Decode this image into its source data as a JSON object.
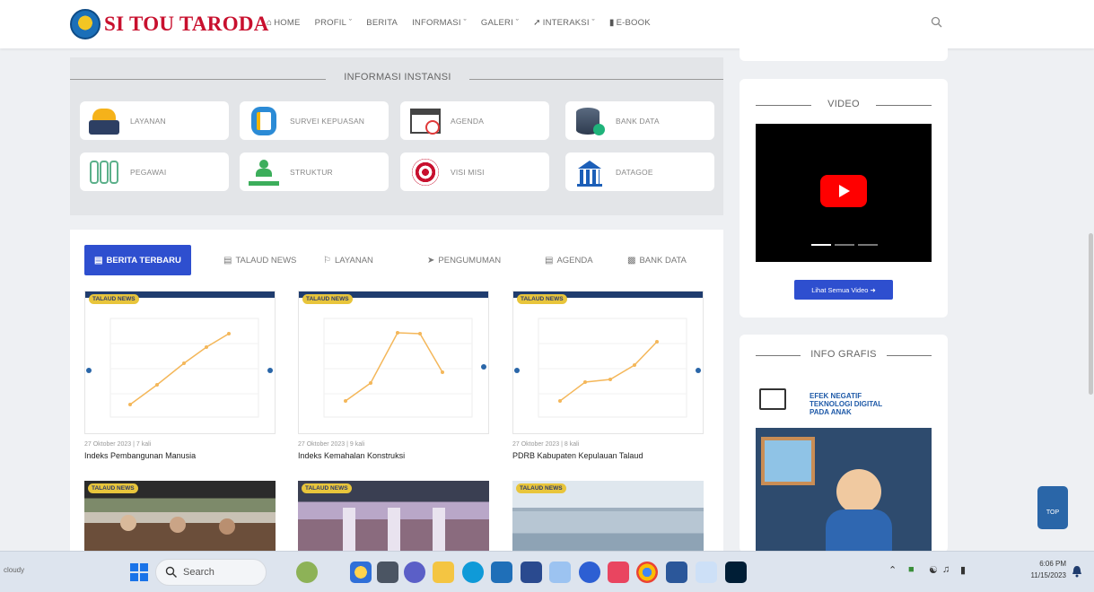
{
  "brand": {
    "name": "SI TOU TARODA"
  },
  "nav": {
    "items": [
      {
        "label": "HOME",
        "icon": "home-icon"
      },
      {
        "label": "PROFIL",
        "dropdown": true
      },
      {
        "label": "BERITA"
      },
      {
        "label": "INFORMASI",
        "dropdown": true
      },
      {
        "label": "GALERI",
        "dropdown": true
      },
      {
        "label": "INTERAKSI",
        "icon": "rocket-icon",
        "dropdown": true
      },
      {
        "label": "E-BOOK",
        "icon": "book-icon"
      }
    ]
  },
  "info": {
    "title": "INFORMASI INSTANSI",
    "tiles": [
      {
        "label": "LAYANAN",
        "icon": "service-icon"
      },
      {
        "label": "SURVEI KEPUASAN",
        "icon": "survey-icon"
      },
      {
        "label": "AGENDA",
        "icon": "calendar-icon"
      },
      {
        "label": "BANK DATA",
        "icon": "database-icon"
      },
      {
        "label": "PEGAWAI",
        "icon": "employees-icon"
      },
      {
        "label": "STRUKTUR",
        "icon": "org-structure-icon"
      },
      {
        "label": "VISI MISI",
        "icon": "target-icon"
      },
      {
        "label": "DATAGOE",
        "icon": "institution-icon"
      }
    ]
  },
  "news": {
    "tabs": [
      {
        "label": "BERITA TERBARU",
        "active": true
      },
      {
        "label": "TALAUD NEWS"
      },
      {
        "label": "LAYANAN"
      },
      {
        "label": "PENGUMUMAN"
      },
      {
        "label": "AGENDA"
      },
      {
        "label": "BANK DATA"
      }
    ],
    "cards": [
      {
        "badge": "TALAUD NEWS",
        "meta": "27 Oktober 2023 | 7 kali",
        "title": "Indeks Pembangunan Manusia"
      },
      {
        "badge": "TALAUD NEWS",
        "meta": "27 Oktober 2023 | 9 kali",
        "title": "Indeks Kemahalan Konstruksi"
      },
      {
        "badge": "TALAUD NEWS",
        "meta": "27 Oktober 2023 | 8 kali",
        "title": "PDRB Kabupaten Kepulauan Talaud"
      },
      {
        "badge": "TALAUD NEWS"
      },
      {
        "badge": "TALAUD NEWS"
      },
      {
        "badge": "TALAUD NEWS"
      }
    ]
  },
  "sidebar": {
    "video_title": "VIDEO",
    "video_button": "Lihat Semua Video",
    "grafis_title": "INFO GRAFIS",
    "poster_text": [
      "EFEK NEGATIF",
      "TEKNOLOGI DIGITAL",
      "PADA ANAK"
    ]
  },
  "top_button": "TOP",
  "taskbar": {
    "left_text": "cloudy",
    "search_placeholder": "Search",
    "time": "6:06 PM",
    "date": "11/15/2023"
  }
}
